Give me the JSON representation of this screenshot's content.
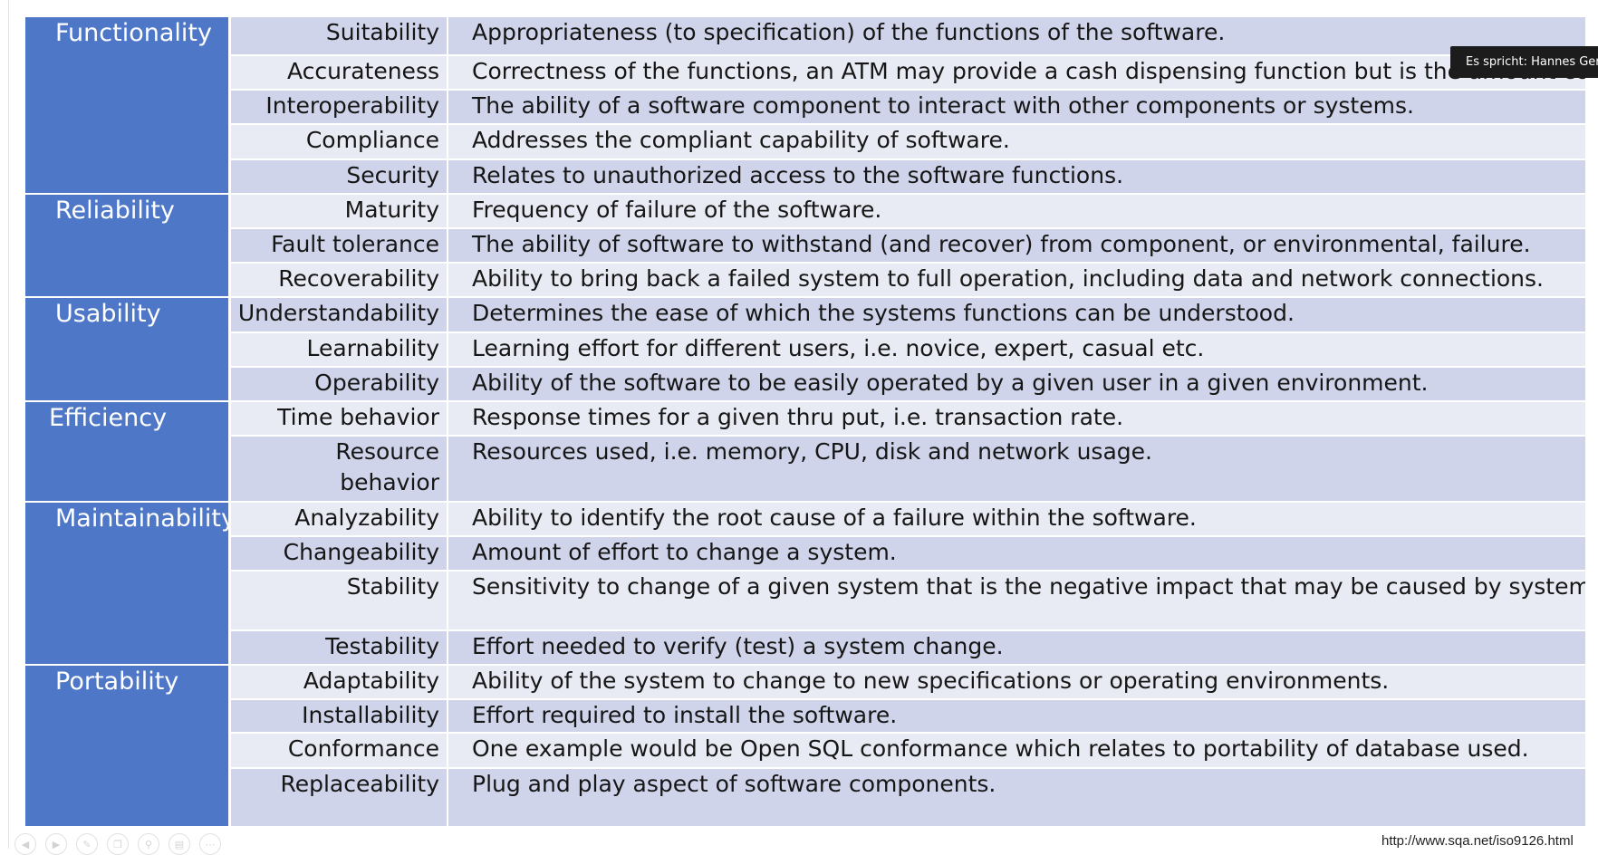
{
  "categories": {
    "functionality": "Functionality",
    "reliability": "Reliability",
    "usability": "Usability",
    "efficiency": "Efficiency",
    "maintainability": "Maintainability",
    "portability": "Portability"
  },
  "rows": [
    {
      "sub": "Suitability",
      "desc": "Appropriateness (to specification) of the functions of the software."
    },
    {
      "sub": "Accurateness",
      "desc": "Correctness of the functions, an ATM may provide a cash dispensing function but is the amount correct?"
    },
    {
      "sub": "Interoperability",
      "desc": "The ability of a software component to interact with other components or systems."
    },
    {
      "sub": "Compliance",
      "desc": "Addresses the compliant capability of software."
    },
    {
      "sub": "Security",
      "desc": "Relates to unauthorized access to the software functions."
    },
    {
      "sub": "Maturity",
      "desc": "Frequency of failure of the software."
    },
    {
      "sub": "Fault tolerance",
      "desc": "The ability of software to withstand (and recover) from component, or environmental, failure."
    },
    {
      "sub": "Recoverability",
      "desc": "Ability to bring back a failed system to full operation, including data and network connections."
    },
    {
      "sub": "Understandability",
      "desc": "Determines the ease of which the systems functions can be understood."
    },
    {
      "sub": "Learnability",
      "desc": "Learning effort for different users, i.e. novice, expert, casual etc."
    },
    {
      "sub": "Operability",
      "desc": "Ability of the software to be easily operated by a given user in a given environment."
    },
    {
      "sub": "Time behavior",
      "desc": "Response times for a given thru put, i.e. transaction rate."
    },
    {
      "sub_line1": "Resource",
      "sub_line2": "behavior",
      "desc": "Resources used, i.e. memory, CPU, disk and network usage."
    },
    {
      "sub": "Analyzability",
      "desc": "Ability to identify the root cause of a failure within the software."
    },
    {
      "sub": "Changeability",
      "desc": "Amount of effort to change a system."
    },
    {
      "sub": "Stability",
      "desc": "Sensitivity to change of a given system that is the negative impact that may be caused by system changes."
    },
    {
      "sub": "Testability",
      "desc": "Effort needed to verify (test) a system change."
    },
    {
      "sub": "Adaptability",
      "desc": "Ability of the system to change to new specifications or operating environments."
    },
    {
      "sub": "Installability",
      "desc": "Effort required to install the software."
    },
    {
      "sub": "Conformance",
      "desc": "One example would be Open SQL conformance which relates to portability of database used."
    },
    {
      "sub": "Replaceability",
      "desc": "Plug and play aspect of software components."
    }
  ],
  "tooltip": "Es spricht: Hannes Gerne",
  "source_url": "http://www.sqa.net/iso9126.html",
  "colors": {
    "category_bg": "#4e77c8",
    "row_dark": "#cfd4ea",
    "row_light": "#e9ebf4",
    "tooltip_bg": "#1c1c1c"
  },
  "toolbar_icons": [
    "back-icon",
    "play-icon",
    "pen-icon",
    "copy-icon",
    "zoom-icon",
    "slides-icon",
    "more-icon"
  ]
}
